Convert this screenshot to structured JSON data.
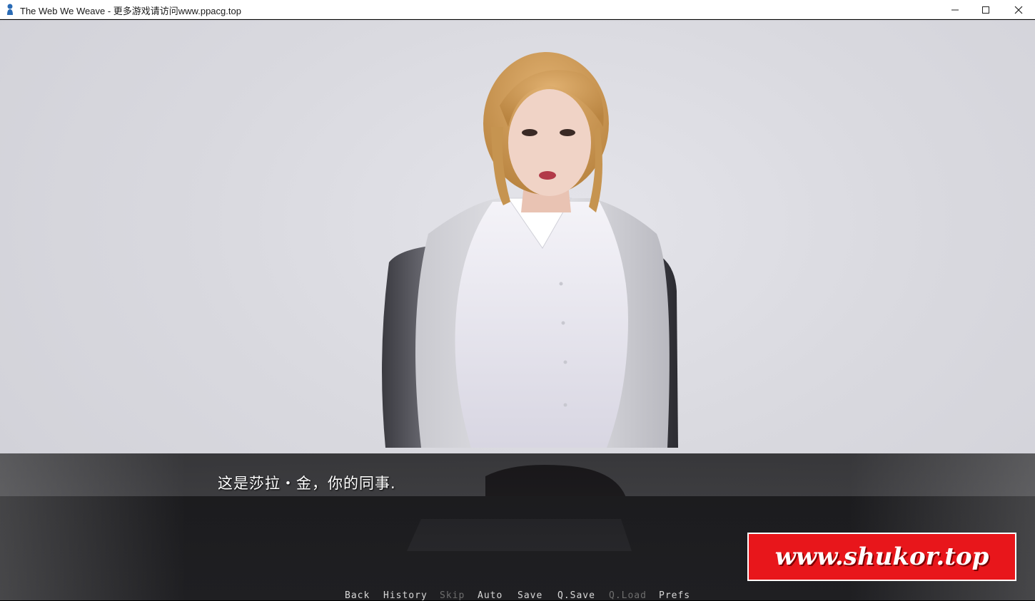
{
  "window": {
    "title": "The Web We Weave - 更多游戏请访问www.ppacg.top",
    "controls": [
      "minimize-icon",
      "maximize-icon",
      "close-icon"
    ]
  },
  "scene": {
    "character": "woman in white blouse and grey blazer seated in a grey chair",
    "background_color": "#d9d9df"
  },
  "dialogue": {
    "text": "这是莎拉・金，你的同事."
  },
  "quick_menu": [
    {
      "label": "Back",
      "enabled": true
    },
    {
      "label": "History",
      "enabled": true
    },
    {
      "label": "Skip",
      "enabled": false
    },
    {
      "label": "Auto",
      "enabled": true
    },
    {
      "label": "Save",
      "enabled": true
    },
    {
      "label": "Q.Save",
      "enabled": true
    },
    {
      "label": "Q.Load",
      "enabled": false
    },
    {
      "label": "Prefs",
      "enabled": true
    }
  ],
  "watermark": {
    "text": "www.shukor.top",
    "color": "#e8161b"
  }
}
